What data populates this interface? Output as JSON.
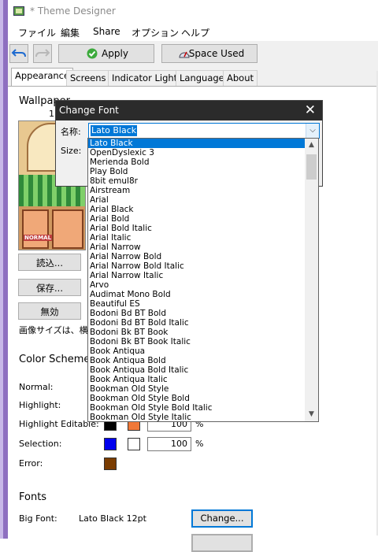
{
  "window": {
    "title": "* Theme Designer"
  },
  "menu": [
    "ファイル",
    "編集",
    "Share",
    "オプション",
    "ヘルプ"
  ],
  "toolbar": {
    "apply_label": "Apply",
    "space_used_label": "Space Used"
  },
  "tabs": [
    "Appearance",
    "Screens",
    "Indicator Light",
    "Language",
    "About"
  ],
  "wallpaper": {
    "label": "Wallpaper",
    "index": "1",
    "image_text": "NORMAL",
    "load_label": "読込...",
    "save_label": "保存...",
    "disable_label": "無効",
    "size_note": "画像サイズは、横"
  },
  "color_scheme": {
    "label": "Color Scheme",
    "rows": [
      {
        "label": "Normal:"
      },
      {
        "label": "Highlight:"
      },
      {
        "label": "Highlight Editable:",
        "value": "100",
        "unit": "%"
      },
      {
        "label": "Selection:",
        "value": "100",
        "unit": "%"
      },
      {
        "label": "Error:"
      }
    ],
    "colors": {
      "selection": "#0000ee",
      "error": "#7a3c00",
      "highlight_editable_primary": "#000000",
      "highlight_editable_secondary": "#f07838"
    }
  },
  "fonts": {
    "label": "Fonts",
    "big_font_label": "Big Font:",
    "big_font_value": "Lato Black 12pt",
    "change_label": "Change..."
  },
  "dialog": {
    "title": "Change Font",
    "name_label": "名称:",
    "size_label": "Size:",
    "selected": "Lato Black",
    "options": [
      "Lato Black",
      "OpenDyslexic 3",
      "Merienda Bold",
      "Play Bold",
      "8bit   emul8r",
      "Airstream",
      "Arial",
      "Arial Black",
      "Arial Bold",
      "Arial Bold Italic",
      "Arial Italic",
      "Arial Narrow",
      "Arial Narrow Bold",
      "Arial Narrow Bold Italic",
      "Arial Narrow Italic",
      "Arvo",
      "Audimat Mono Bold",
      "Beautiful ES",
      "Bodoni Bd BT Bold",
      "Bodoni Bd BT Bold Italic",
      "Bodoni Bk BT Book",
      "Bodoni Bk BT Book Italic",
      "Book Antiqua",
      "Book Antiqua Bold",
      "Book Antiqua Bold Italic",
      "Book Antiqua Italic",
      "Bookman Old Style",
      "Bookman Old Style Bold",
      "Bookman Old Style Bold Italic",
      "Bookman Old Style Italic"
    ]
  }
}
